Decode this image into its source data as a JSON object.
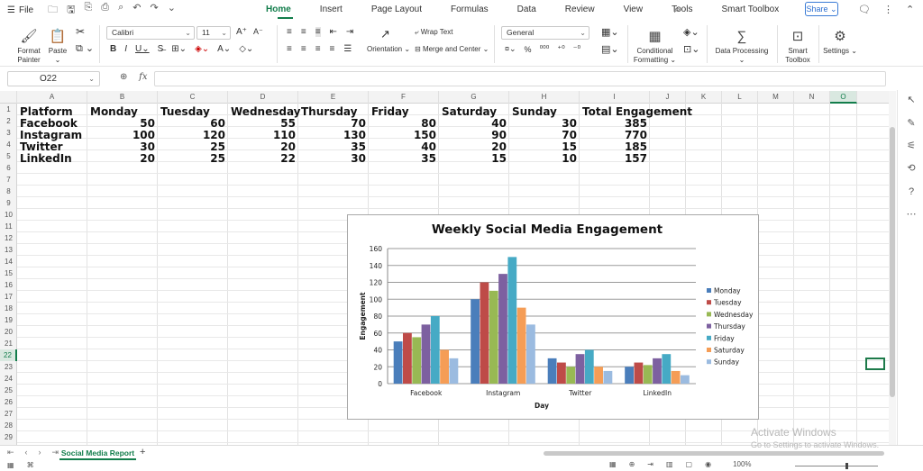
{
  "menubar": {
    "file_label": "File",
    "tabs": [
      "Home",
      "Insert",
      "Page Layout",
      "Formulas",
      "Data",
      "Review",
      "View",
      "Tools",
      "Smart Toolbox"
    ],
    "active_tab": "Home",
    "share_label": "Share"
  },
  "ribbon": {
    "format_painter": "Format Painter",
    "paste": "Paste",
    "font_name": "Calibri",
    "font_size": "11",
    "wrap_text": "Wrap Text",
    "orientation": "Orientation",
    "merge_center": "Merge and Center",
    "number_format": "General",
    "conditional_formatting": "Conditional Formatting",
    "data_processing": "Data Processing",
    "smart_toolbox": "Smart Toolbox",
    "settings": "Settings"
  },
  "formula_bar": {
    "name_box": "O22",
    "fx": "fx",
    "formula": ""
  },
  "columns": [
    "A",
    "B",
    "C",
    "D",
    "E",
    "F",
    "G",
    "H",
    "I",
    "J",
    "K",
    "L",
    "M",
    "N",
    "O"
  ],
  "selected_column": "O",
  "rows": [
    "1",
    "2",
    "3",
    "4",
    "5",
    "6",
    "7",
    "8",
    "9",
    "10",
    "11",
    "12",
    "13",
    "14",
    "15",
    "16",
    "17",
    "18",
    "19",
    "20",
    "21",
    "22",
    "23",
    "24",
    "25",
    "26",
    "27",
    "28",
    "29"
  ],
  "selected_row": "22",
  "table": {
    "headers": [
      "Platform",
      "Monday",
      "Tuesday",
      "Wednesday",
      "Thursday",
      "Friday",
      "Saturday",
      "Sunday",
      "Total Engagement"
    ],
    "rows": [
      [
        "Facebook",
        "50",
        "60",
        "55",
        "70",
        "80",
        "40",
        "30",
        "385"
      ],
      [
        "Instagram",
        "100",
        "120",
        "110",
        "130",
        "150",
        "90",
        "70",
        "770"
      ],
      [
        "Twitter",
        "30",
        "25",
        "20",
        "35",
        "40",
        "20",
        "15",
        "185"
      ],
      [
        "LinkedIn",
        "20",
        "25",
        "22",
        "30",
        "35",
        "15",
        "10",
        "157"
      ]
    ]
  },
  "chart_data": {
    "type": "bar",
    "title": "Weekly Social Media Engagement",
    "xlabel": "Day",
    "ylabel": "Engagement",
    "categories": [
      "Facebook",
      "Instagram",
      "Twitter",
      "LinkedIn"
    ],
    "ylim": [
      0,
      160
    ],
    "yticks": [
      0,
      20,
      40,
      60,
      80,
      100,
      120,
      140,
      160
    ],
    "grid": true,
    "legend": "right",
    "series": [
      {
        "name": "Monday",
        "color": "#4a7ebb",
        "values": [
          50,
          100,
          30,
          20
        ]
      },
      {
        "name": "Tuesday",
        "color": "#be4b48",
        "values": [
          60,
          120,
          25,
          25
        ]
      },
      {
        "name": "Wednesday",
        "color": "#98b954",
        "values": [
          55,
          110,
          20,
          22
        ]
      },
      {
        "name": "Thursday",
        "color": "#7d60a0",
        "values": [
          70,
          130,
          35,
          30
        ]
      },
      {
        "name": "Friday",
        "color": "#46aac5",
        "values": [
          80,
          150,
          40,
          35
        ]
      },
      {
        "name": "Saturday",
        "color": "#f59d56",
        "values": [
          40,
          90,
          20,
          15
        ]
      },
      {
        "name": "Sunday",
        "color": "#9bbbe0",
        "values": [
          30,
          70,
          15,
          10
        ]
      }
    ]
  },
  "sheets": [
    "Social Media Report"
  ],
  "active_sheet": "Social Media Report",
  "status": {
    "zoom": "100%"
  },
  "watermark": {
    "line1": "Activate Windows",
    "line2": "Go to Settings to activate Windows."
  }
}
